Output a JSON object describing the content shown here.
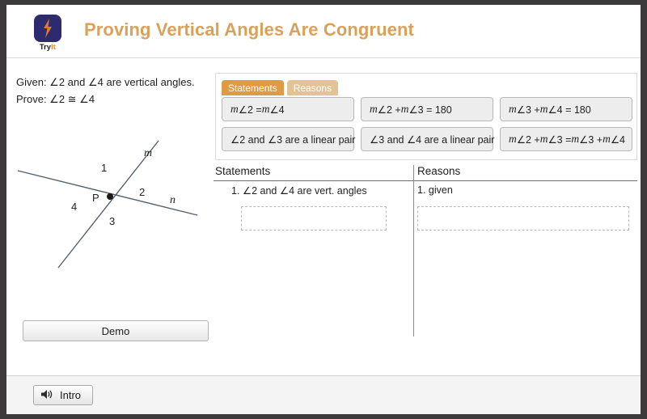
{
  "header": {
    "logo_caption_bold": "Try",
    "logo_caption_accent": "It",
    "logo_icon": "lightning-bolt-icon",
    "title": "Proving Vertical Angles Are Congruent",
    "title_color": "#d9a15a",
    "logo_bg_color": "#2e2a6e",
    "logo_bolt_color": "#e07b2a"
  },
  "problem": {
    "given": "Given: ∠2 and ∠4 are vertical angles.",
    "prove": "Prove: ∠2 ≅ ∠4"
  },
  "diagram": {
    "point_label": "P",
    "line_m_label": "m",
    "line_n_label": "n",
    "angle_1": "1",
    "angle_2": "2",
    "angle_3": "3",
    "angle_4": "4",
    "line_color": "#55606b"
  },
  "demo_button": {
    "label": "Demo"
  },
  "tiles_panel": {
    "tabs": [
      {
        "label": "Statements",
        "active": true,
        "color": "#e09a45"
      },
      {
        "label": "Reasons",
        "active": false,
        "color": "#e3c392"
      }
    ],
    "rows": [
      [
        {
          "pre": "m",
          "post": "∠2 = ",
          "pre2": "m",
          "post2": "∠4",
          "text": "m∠2 = m∠4"
        },
        {
          "text": "m∠2 + m∠3 = 180"
        },
        {
          "text": "m∠3 + m∠4 = 180"
        }
      ],
      [
        {
          "text": "∠2 and ∠3 are a linear pair"
        },
        {
          "text": "∠3 and ∠4 are a linear pair"
        },
        {
          "text": "m∠2 + m∠3 = m∠3 + m∠4"
        }
      ]
    ]
  },
  "proof_table": {
    "columns": [
      "Statements",
      "Reasons"
    ],
    "rows": [
      {
        "statement": "1. ∠2 and ∠4 are vert. angles",
        "reason": "1. given"
      }
    ],
    "empty_dropzones": 2
  },
  "footer": {
    "intro_button_label": "Intro",
    "intro_button_icon": "speaker-icon"
  }
}
